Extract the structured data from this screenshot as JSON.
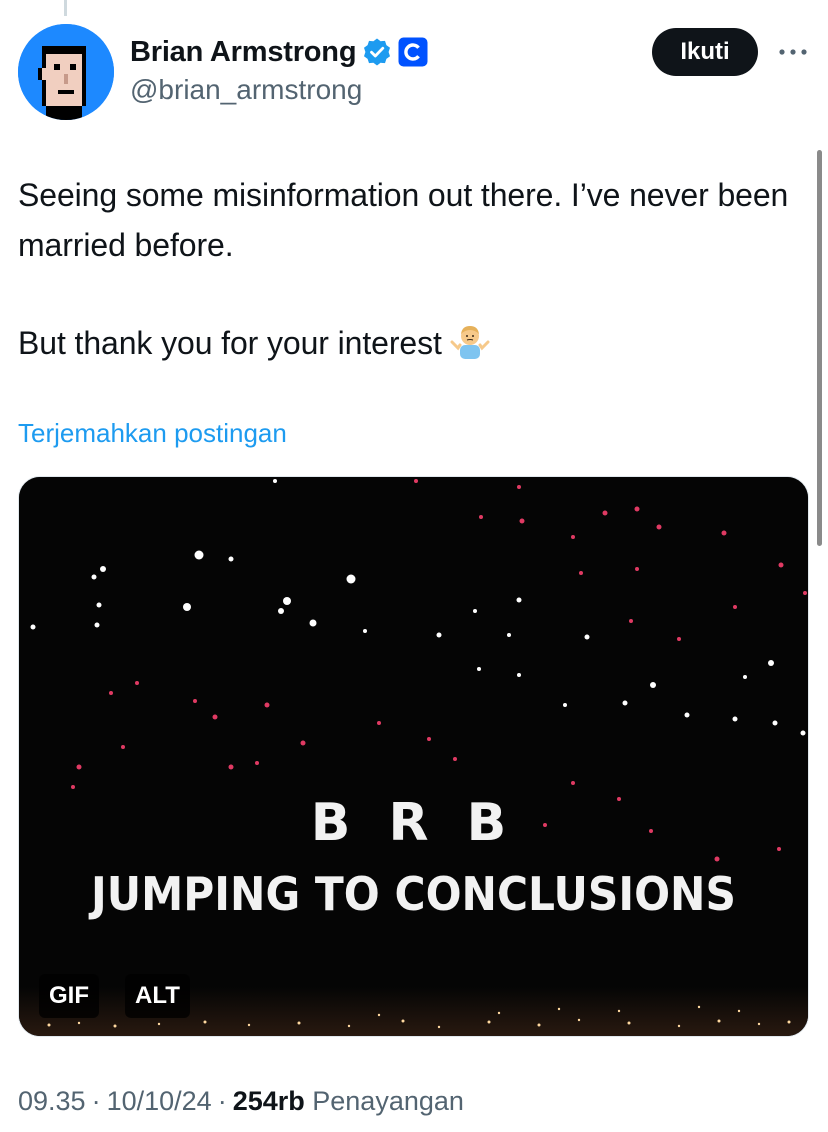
{
  "author": {
    "display_name": "Brian Armstrong",
    "handle": "@brian_armstrong"
  },
  "actions": {
    "follow_label": "Ikuti",
    "more_icon": "more-dots-icon"
  },
  "tweet": {
    "line1": "Seeing some misinformation out there. I’ve never been married before.",
    "line2": "But thank you for your interest",
    "translate_label": "Terjemahkan postingan"
  },
  "media": {
    "caption_top": "B R B",
    "caption_bottom": "JUMPING TO CONCLUSIONS",
    "gif_badge": "GIF",
    "alt_badge": "ALT"
  },
  "meta": {
    "time": "09.35",
    "sep1": "·",
    "date": "10/10/24",
    "sep2": "·",
    "views_count": "254rb",
    "views_label": "Penayangan"
  },
  "colors": {
    "link": "#1d9bf0",
    "secondary_text": "#536471",
    "verified": "#1d9bf0",
    "brand_badge": "#0052ff"
  }
}
